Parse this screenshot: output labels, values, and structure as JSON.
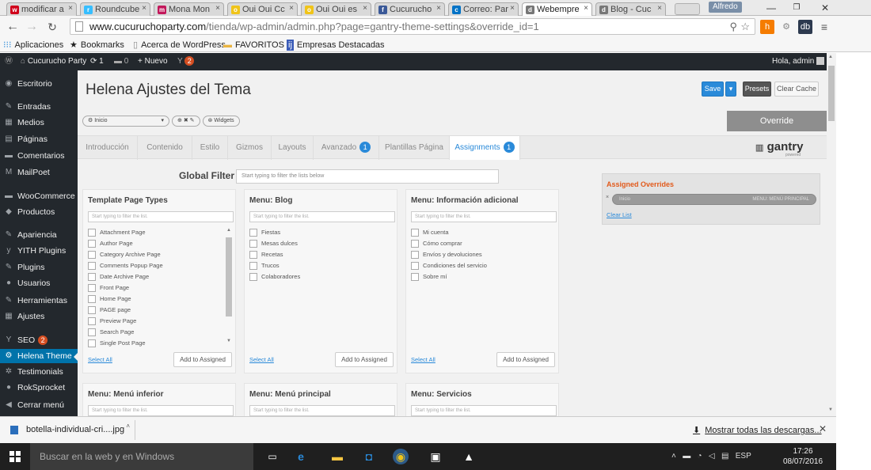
{
  "browser": {
    "tabs": [
      {
        "label": "modificar a",
        "icon": "w",
        "color": "#d0021b"
      },
      {
        "label": "Roundcube",
        "icon": "r",
        "color": "#37beff"
      },
      {
        "label": "Mona Mon",
        "icon": "m",
        "color": "#c2185b"
      },
      {
        "label": "Oui Oui Cc",
        "icon": "o",
        "color": "#f0c419"
      },
      {
        "label": "Oui Oui es",
        "icon": "o",
        "color": "#f0c419"
      },
      {
        "label": "Cucurucho",
        "icon": "f",
        "color": "#3b5998"
      },
      {
        "label": "Correo: Par",
        "icon": "c",
        "color": "#0072c6"
      },
      {
        "label": "Webempre",
        "icon": "d",
        "color": "#777777"
      },
      {
        "label": "Blog - Cuc",
        "icon": "d",
        "color": "#777777"
      }
    ],
    "active_tab_index": 7,
    "profile_name": "Alfredo",
    "window_controls": {
      "minimize": "—",
      "maximize": "❐",
      "close": "✕"
    },
    "url_host": "www.cucuruchoparty.com",
    "url_path": "/tienda/wp-admin/admin.php?page=gantry-theme-settings&override_id=1",
    "bookmarks": [
      "Aplicaciones",
      "Bookmarks",
      "Acerca de WordPress",
      "FAVORITOS",
      "Empresas Destacadas"
    ]
  },
  "adminbar": {
    "site": "Cucurucho Party",
    "updates": "1",
    "comments": "0",
    "new_label": "Nuevo",
    "yoast_count": "2",
    "greeting": "Hola, admin"
  },
  "sidebar": {
    "items": [
      {
        "label": "Escritorio",
        "icon": "◉"
      },
      {
        "label": "Entradas",
        "icon": "✎"
      },
      {
        "label": "Medios",
        "icon": "▦"
      },
      {
        "label": "Páginas",
        "icon": "▤"
      },
      {
        "label": "Comentarios",
        "icon": "▬"
      },
      {
        "label": "MailPoet",
        "icon": "M"
      },
      {
        "label": "WooCommerce",
        "icon": "▬"
      },
      {
        "label": "Productos",
        "icon": "◆"
      },
      {
        "label": "Apariencia",
        "icon": "✎"
      },
      {
        "label": "YITH Plugins",
        "icon": "y"
      },
      {
        "label": "Plugins",
        "icon": "✎"
      },
      {
        "label": "Usuarios",
        "icon": "●"
      },
      {
        "label": "Herramientas",
        "icon": "✎"
      },
      {
        "label": "Ajustes",
        "icon": "▦"
      },
      {
        "label": "SEO",
        "icon": "Y",
        "badge": "2"
      },
      {
        "label": "Helena Theme",
        "icon": "⚙",
        "active": true
      },
      {
        "label": "Testimonials",
        "icon": "✲"
      },
      {
        "label": "RokSprocket",
        "icon": "●"
      },
      {
        "label": "Cerrar menú",
        "icon": "◀"
      }
    ]
  },
  "main": {
    "title": "Helena Ajustes del Tema",
    "buttons": {
      "save": "Save",
      "presets": "Presets",
      "clear_cache": "Clear Cache"
    },
    "outline_select": "Inicio",
    "widgets_label": "Widgets",
    "override_label": "Override",
    "tabs": [
      {
        "label": "Introducción"
      },
      {
        "label": "Contenido"
      },
      {
        "label": "Estilo"
      },
      {
        "label": "Gizmos"
      },
      {
        "label": "Layouts"
      },
      {
        "label": "Avanzado",
        "badge": "1"
      },
      {
        "label": "Plantillas Página"
      },
      {
        "label": "Assignments",
        "badge": "1",
        "active": true
      }
    ],
    "logo_text": "gantry",
    "logo_sub": "powered",
    "global_filter_label": "Global Filter",
    "global_filter_placeholder": "Start typing to filter the lists below",
    "list_placeholder": "Start typing to filter the list.",
    "select_all": "Select All",
    "add_to_assigned": "Add to Assigned",
    "cards": [
      {
        "title": "Template Page Types",
        "items": [
          "Attachment Page",
          "Author Page",
          "Category Archive Page",
          "Comments Popup Page",
          "Date Archive Page",
          "Front Page",
          "Home Page",
          "PAGE page",
          "Preview Page",
          "Search Page",
          "Single Post Page"
        ]
      },
      {
        "title": "Menu: Blog",
        "items": [
          "Fiestas",
          "Mesas dulces",
          "Recetas",
          "Trucos",
          "Colaboradores"
        ]
      },
      {
        "title": "Menu: Información adicional",
        "items": [
          "Mi cuenta",
          "Cómo comprar",
          "Envíos y devoluciones",
          "Condiciones del servicio",
          "Sobre mí"
        ]
      }
    ],
    "cards_bottom": [
      "Menu: Menú inferior",
      "Menu: Menú principal",
      "Menu: Servicios"
    ],
    "assigned": {
      "title": "Assigned Overrides",
      "item_label": "Inicio",
      "item_right": "MENU: MENÚ PRINCIPAL",
      "clear": "Clear List"
    }
  },
  "downloads": {
    "file": "botella-individual-cri....jpg",
    "show_all": "Mostrar todas las descargas...",
    "close": "✕"
  },
  "taskbar": {
    "search_placeholder": "Buscar en la web y en Windows",
    "lang": "ESP",
    "time": "17:26",
    "date": "08/07/2016"
  }
}
